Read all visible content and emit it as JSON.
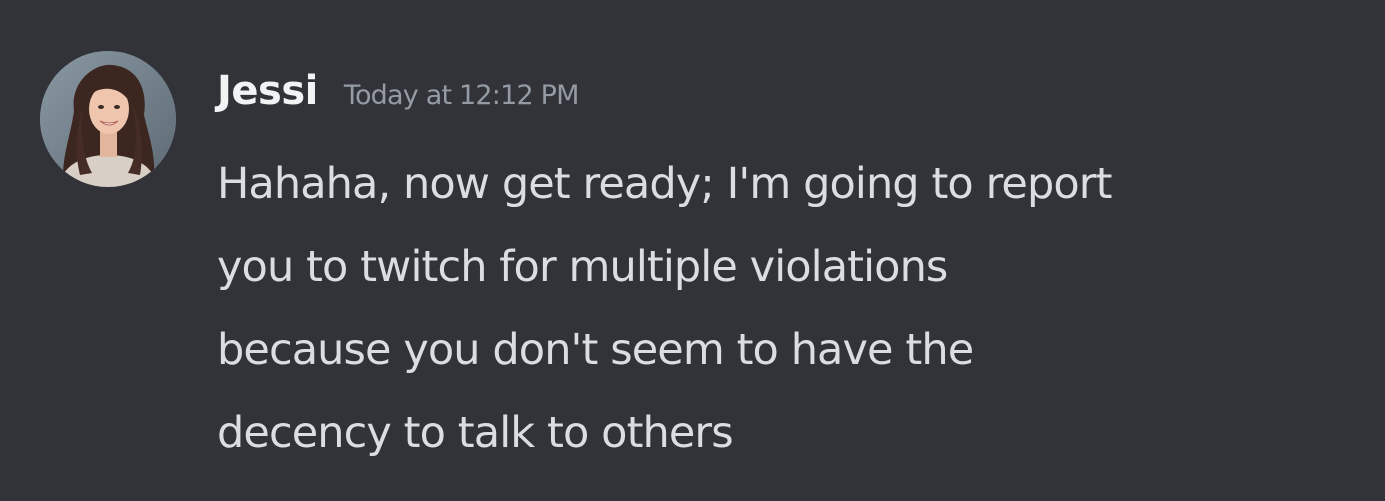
{
  "message": {
    "author": "Jessi",
    "timestamp": "Today at 12:12 PM",
    "content_lines": [
      "Hahaha, now get ready; I'm going to report",
      "you to twitch for multiple violations",
      "because you don't seem to have the",
      "decency to talk to others"
    ]
  },
  "colors": {
    "background": "#313338",
    "username": "#f2f3f5",
    "timestamp": "#949ba4",
    "message_text": "#dbdee1"
  },
  "icons": {
    "avatar": "user-avatar-photo"
  }
}
